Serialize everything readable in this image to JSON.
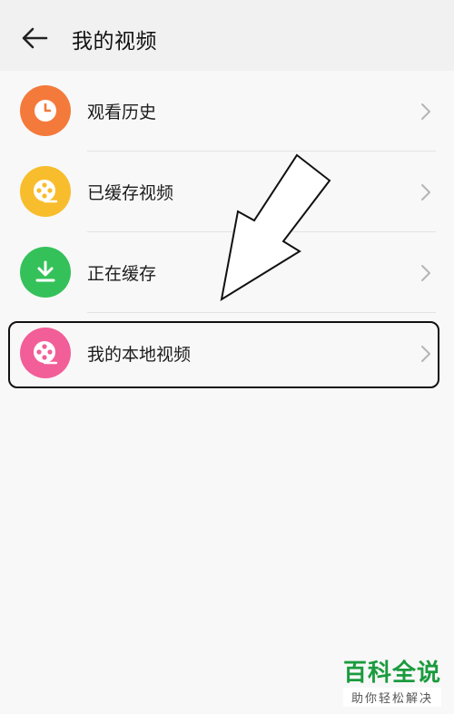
{
  "header": {
    "title": "我的视频"
  },
  "items": [
    {
      "label": "观看历史",
      "icon": "clock-icon",
      "color": "#f47a3c"
    },
    {
      "label": "已缓存视频",
      "icon": "film-reel-icon",
      "color": "#f8bd2c"
    },
    {
      "label": "正在缓存",
      "icon": "download-icon",
      "color": "#35c15a"
    },
    {
      "label": "我的本地视频",
      "icon": "film-reel-icon",
      "color": "#f25e98"
    }
  ],
  "watermark": {
    "title": "百科全说",
    "subtitle": "助你轻松解决"
  }
}
